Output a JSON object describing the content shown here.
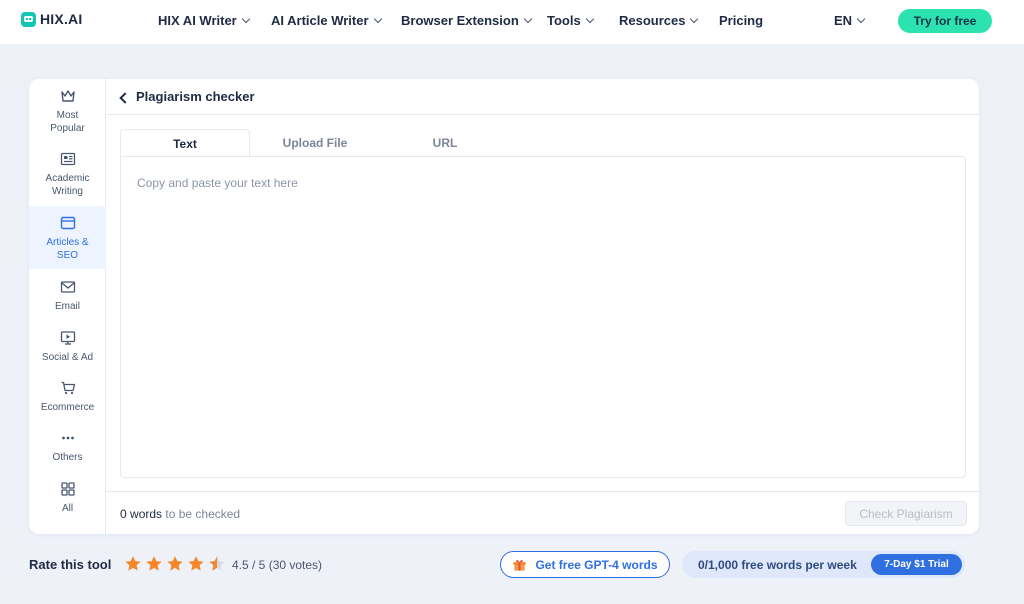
{
  "brand": {
    "name": "HIX.AI"
  },
  "nav": {
    "items": [
      {
        "label": "HIX AI Writer",
        "has_dropdown": true
      },
      {
        "label": "AI Article Writer",
        "has_dropdown": true
      },
      {
        "label": "Browser Extension",
        "has_dropdown": true
      },
      {
        "label": "Tools",
        "has_dropdown": true
      },
      {
        "label": "Resources",
        "has_dropdown": true
      },
      {
        "label": "Pricing",
        "has_dropdown": false
      },
      {
        "label": "EN",
        "has_dropdown": true
      }
    ],
    "cta_label": "Try for free"
  },
  "sidebar": {
    "items": [
      {
        "label": "Most\nPopular",
        "icon": "crown-icon",
        "active": false
      },
      {
        "label": "Academic\nWriting",
        "icon": "newspaper-icon",
        "active": false
      },
      {
        "label": "Articles &\nSEO",
        "icon": "browser-window-icon",
        "active": true
      },
      {
        "label": "Email",
        "icon": "envelope-icon",
        "active": false
      },
      {
        "label": "Social & Ad",
        "icon": "monitor-play-icon",
        "active": false
      },
      {
        "label": "Ecommerce",
        "icon": "cart-icon",
        "active": false
      },
      {
        "label": "Others",
        "icon": "more-dots-icon",
        "active": false
      },
      {
        "label": "All",
        "icon": "grid-icon",
        "active": false
      }
    ]
  },
  "tool": {
    "title": "Plagiarism checker",
    "tabs": [
      {
        "label": "Text",
        "active": true
      },
      {
        "label": "Upload File",
        "active": false
      },
      {
        "label": "URL",
        "active": false
      }
    ],
    "editor": {
      "placeholder": "Copy and paste your text here",
      "value": ""
    },
    "word_count": "0",
    "word_count_suffix": "words",
    "word_count_tail": "to be checked",
    "check_button_label": "Check Plagiarism"
  },
  "rating": {
    "label": "Rate this tool",
    "stars": 4.5,
    "max": 5,
    "text": "4.5 / 5 (30 votes)"
  },
  "promo": {
    "gpt_label": "Get free GPT-4 words",
    "quota_text": "0/1,000 free words per week",
    "trial_label": "7-Day $1 Trial"
  },
  "colors": {
    "accent": "#2f6fe0",
    "cta": "#2ce3b0",
    "brand": "#13c6b3",
    "star": "#f5872a"
  }
}
